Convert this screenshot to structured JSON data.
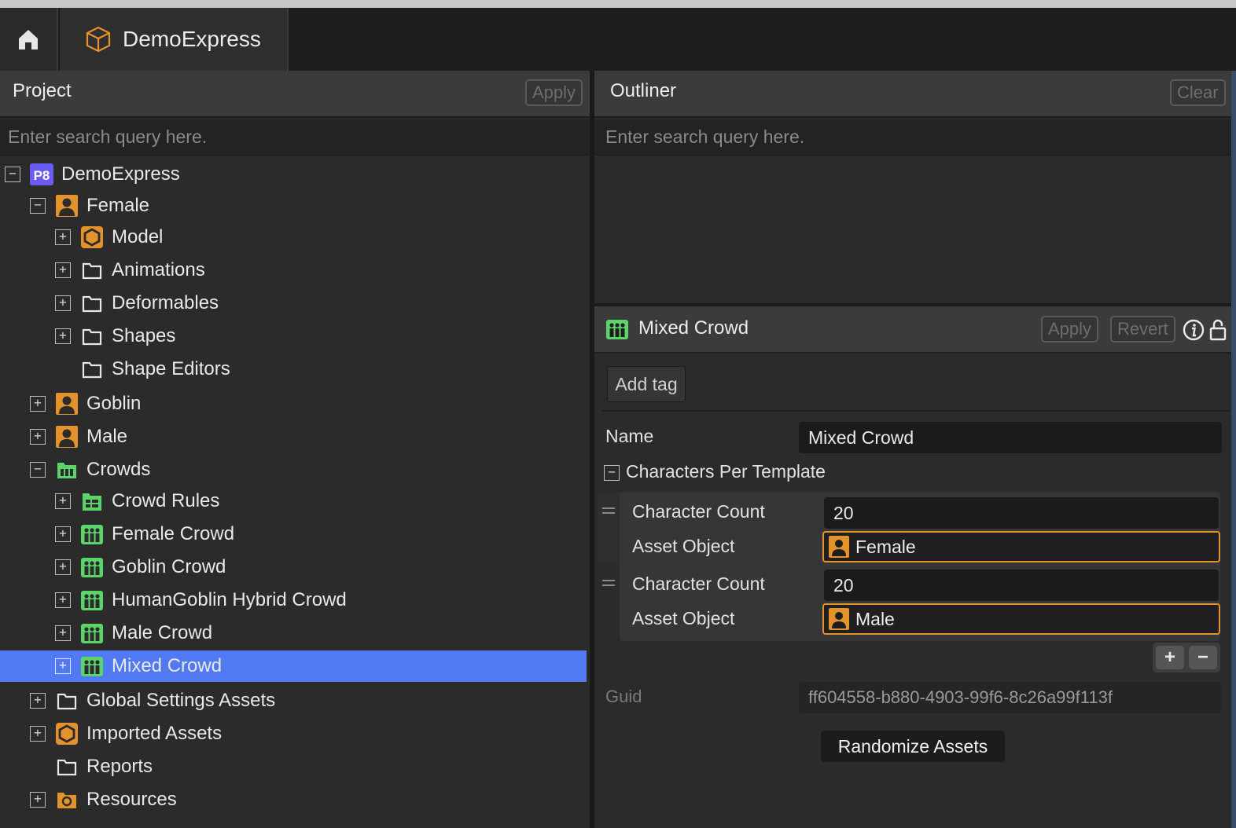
{
  "app": {
    "tab_title": "DemoExpress"
  },
  "project": {
    "title": "Project",
    "apply_label": "Apply",
    "search_placeholder": "Enter search query here.",
    "tree": [
      {
        "label": "DemoExpress",
        "icon": "project-p8-icon",
        "depth": 0,
        "toggle": "minus"
      },
      {
        "label": "Female",
        "icon": "character-icon",
        "depth": 1,
        "toggle": "minus"
      },
      {
        "label": "Model",
        "icon": "model-hexagon-icon",
        "depth": 2,
        "toggle": "plus"
      },
      {
        "label": "Animations",
        "icon": "folder-icon",
        "depth": 2,
        "toggle": "plus"
      },
      {
        "label": "Deformables",
        "icon": "folder-icon",
        "depth": 2,
        "toggle": "plus"
      },
      {
        "label": "Shapes",
        "icon": "folder-icon",
        "depth": 2,
        "toggle": "plus"
      },
      {
        "label": "Shape Editors",
        "icon": "folder-icon",
        "depth": 2,
        "toggle": "none"
      },
      {
        "label": "Goblin",
        "icon": "character-icon",
        "depth": 1,
        "toggle": "plus"
      },
      {
        "label": "Male",
        "icon": "character-icon",
        "depth": 1,
        "toggle": "plus"
      },
      {
        "label": "Crowds",
        "icon": "crowd-folder-icon",
        "depth": 1,
        "toggle": "minus"
      },
      {
        "label": "Crowd Rules",
        "icon": "crowd-rules-icon",
        "depth": 2,
        "toggle": "plus"
      },
      {
        "label": "Female Crowd",
        "icon": "crowd-icon",
        "depth": 2,
        "toggle": "plus"
      },
      {
        "label": "Goblin Crowd",
        "icon": "crowd-icon",
        "depth": 2,
        "toggle": "plus"
      },
      {
        "label": "HumanGoblin Hybrid Crowd",
        "icon": "crowd-icon",
        "depth": 2,
        "toggle": "plus"
      },
      {
        "label": "Male Crowd",
        "icon": "crowd-icon",
        "depth": 2,
        "toggle": "plus"
      },
      {
        "label": "Mixed Crowd",
        "icon": "crowd-icon",
        "depth": 2,
        "toggle": "plus",
        "selected": true
      },
      {
        "label": "Global Settings Assets",
        "icon": "folder-icon",
        "depth": 1,
        "toggle": "plus"
      },
      {
        "label": "Imported Assets",
        "icon": "model-hexagon-icon",
        "depth": 1,
        "toggle": "plus"
      },
      {
        "label": "Reports",
        "icon": "folder-icon",
        "depth": 1,
        "toggle": "none"
      },
      {
        "label": "Resources",
        "icon": "resource-folder-icon",
        "depth": 1,
        "toggle": "plus"
      }
    ]
  },
  "outliner": {
    "title": "Outliner",
    "clear_label": "Clear",
    "search_placeholder": "Enter search query here."
  },
  "properties": {
    "title": "Mixed Crowd",
    "apply_label": "Apply",
    "revert_label": "Revert",
    "add_tag_label": "Add tag",
    "name_label": "Name",
    "name_value": "Mixed Crowd",
    "section_label": "Characters Per Template",
    "entries": [
      {
        "count_label": "Character Count",
        "count_value": "20",
        "asset_label": "Asset Object",
        "asset_value": "Female"
      },
      {
        "count_label": "Character Count",
        "count_value": "20",
        "asset_label": "Asset Object",
        "asset_value": "Male"
      }
    ],
    "add_symbol": "+",
    "remove_symbol": "−",
    "guid_label": "Guid",
    "guid_value": "ff604558-b880-4903-99f6-8c26a99f113f",
    "randomize_label": "Randomize Assets"
  },
  "colors": {
    "selection": "#5079f2",
    "accent_orange": "#e4922b",
    "crowd_green": "#5bd46a",
    "p8_purple": "#6a5cf0"
  }
}
